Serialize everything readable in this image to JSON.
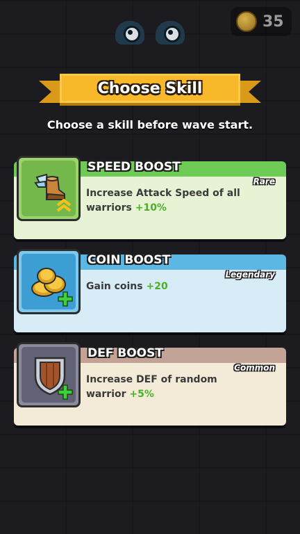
{
  "hud": {
    "coins": "35",
    "coin_icon": "coin-icon"
  },
  "header": {
    "title": "Choose Skill",
    "subtitle": "Choose a skill before wave start."
  },
  "skills": [
    {
      "name": "SPEED BOOST",
      "rarity": "Rare",
      "desc": "Increase Attack Speed of all warriors",
      "bonus": "+10%",
      "icon": "winged-boot-icon",
      "color": "#6ecb55"
    },
    {
      "name": "COIN BOOST",
      "rarity": "Legendary",
      "desc": "Gain coins",
      "bonus": "+20",
      "icon": "coin-stack-icon",
      "color": "#5db7e3"
    },
    {
      "name": "DEF BOOST",
      "rarity": "Common",
      "desc": "Increase DEF of random warrior",
      "bonus": "+5%",
      "icon": "shield-icon",
      "color": "#c2a395"
    }
  ]
}
